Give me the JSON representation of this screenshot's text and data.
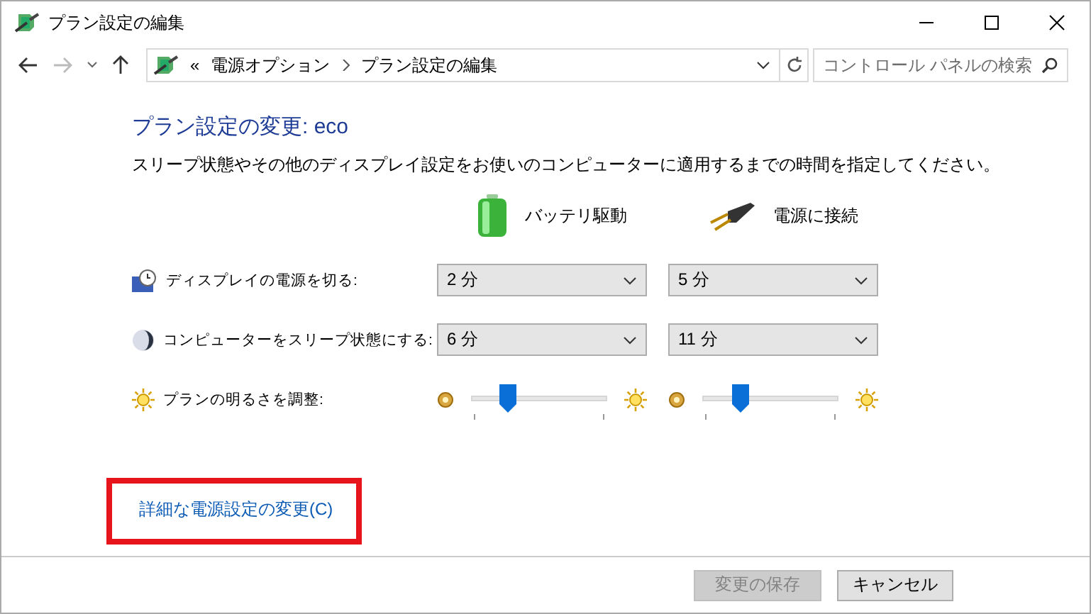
{
  "window": {
    "title": "プラン設定の編集"
  },
  "address_bar": {
    "overflow_mark": "«",
    "path": [
      {
        "label": "電源オプション"
      },
      {
        "label": "プラン設定の編集"
      }
    ]
  },
  "search": {
    "placeholder": "コントロール パネルの検索"
  },
  "heading": "プラン設定の変更: eco",
  "description": "スリープ状態やその他のディスプレイ設定をお使いのコンピューターに適用するまでの時間を指定してください。",
  "columns": [
    {
      "kind": "battery",
      "label": "バッテリ駆動"
    },
    {
      "kind": "plug",
      "label": "電源に接続"
    }
  ],
  "settings": [
    {
      "kind": "dropdown",
      "label": "ディスプレイの電源を切る:",
      "values": [
        {
          "value": "2 分"
        },
        {
          "value": "5 分"
        }
      ]
    },
    {
      "kind": "dropdown",
      "label": "コンピューターをスリープ状態にする:",
      "values": [
        {
          "value": "6 分"
        },
        {
          "value": "11 分"
        }
      ]
    },
    {
      "kind": "slider",
      "label": "プランの明るさを調整:",
      "values": [
        {
          "level": 0.27
        },
        {
          "level": 0.28
        }
      ]
    }
  ],
  "link": {
    "label": "詳細な電源設定の変更(C)",
    "highlighted": true
  },
  "buttons": [
    {
      "label": "変更の保存",
      "disabled": true
    },
    {
      "label": "キャンセル",
      "disabled": false
    }
  ]
}
